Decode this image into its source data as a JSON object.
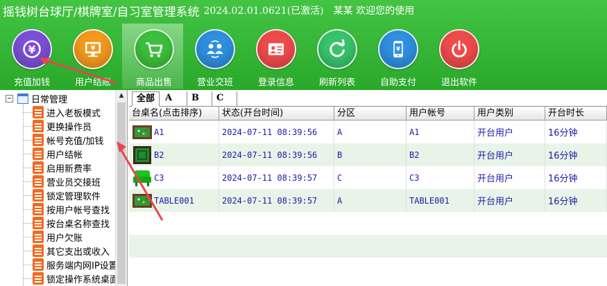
{
  "app": {
    "title": "摇钱树台球厅/棋牌室/自习室管理系统",
    "version": "2024.02.01.0621(已激活)",
    "greeting": "某某 欢迎您的使用"
  },
  "toolbar": {
    "buttons": [
      {
        "label": "充值加钱",
        "icon": "yen-coin-icon",
        "color": "#7b4fd6"
      },
      {
        "label": "用户结账",
        "icon": "monitor-yen-icon",
        "color": "#f39a1e"
      },
      {
        "label": "商品出售",
        "icon": "shopping-cart-icon",
        "color": "#3cbf3c"
      },
      {
        "label": "营业交班",
        "icon": "users-exchange-icon",
        "color": "#2f8fe0"
      },
      {
        "label": "登录信息",
        "icon": "id-card-icon",
        "color": "#ef4b4b"
      },
      {
        "label": "刷新列表",
        "icon": "refresh-icon",
        "color": "#38c46a"
      },
      {
        "label": "自助支付",
        "icon": "phone-pay-icon",
        "color": "#2f8fe0"
      },
      {
        "label": "退出软件",
        "icon": "power-icon",
        "color": "#ef4b4b"
      }
    ]
  },
  "tree": {
    "root_label": "日常管理",
    "toggle": "−",
    "items": [
      "进入老板模式",
      "更换操作员",
      "帐号充值/加钱",
      "用户结帐",
      "启用新费率",
      "营业员交接班",
      "锁定管理软件",
      "按用户帐号查找",
      "按台桌名称查找",
      "用户欠账",
      "其它支出或收入",
      "服务端内网IP设置",
      "锁定操作系统桌面"
    ]
  },
  "tabs": [
    "全部",
    "A",
    "B",
    "C"
  ],
  "table": {
    "columns": [
      "台桌名(点击排序)",
      "状态(开台时间)",
      "分区",
      "用户帐号",
      "用户类别",
      "开台时长"
    ],
    "rows": [
      {
        "name": "A1",
        "icon": "pool-table-icon",
        "status": "2024-07-11 08:39:56",
        "zone": "A",
        "account": "A1",
        "type": "开台用户",
        "duration": "16分钟"
      },
      {
        "name": "B2",
        "icon": "mahjong-table-icon",
        "status": "2024-07-11 08:39:56",
        "zone": "B",
        "account": "B2",
        "type": "开台用户",
        "duration": "16分钟"
      },
      {
        "name": "C3",
        "icon": "sofa-icon",
        "status": "2024-07-11 08:39:57",
        "zone": "C",
        "account": "C3",
        "type": "开台用户",
        "duration": "16分钟"
      },
      {
        "name": "TABLE001",
        "icon": "pool-table-icon",
        "status": "2024-07-11 08:39:57",
        "zone": "A",
        "account": "TABLE001",
        "type": "开台用户",
        "duration": "16分钟"
      }
    ]
  },
  "colors": {
    "header_green": "#2aa82a",
    "even_row": "#e8f4e8",
    "cell_text": "#1a1aa8",
    "doc_icon": "#f26a21",
    "annotation_arrow": "#e8454c"
  }
}
